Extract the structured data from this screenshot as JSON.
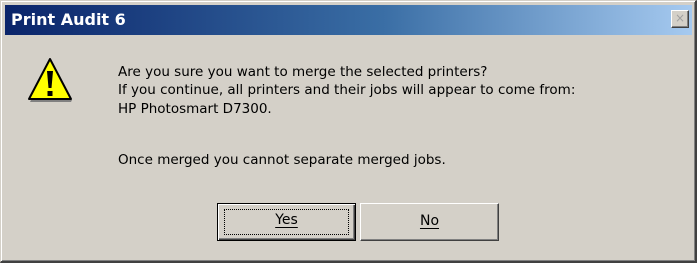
{
  "window": {
    "title": "Print Audit 6",
    "close_glyph": "×"
  },
  "icon": {
    "name": "warning-icon",
    "color": "#ffff00"
  },
  "message": {
    "line1": "Are you sure you want to merge the selected printers?",
    "line2": "If you continue, all printers and their jobs will appear to come from:",
    "line3": "HP Photosmart D7300.",
    "line4": "Once merged you cannot separate merged jobs."
  },
  "buttons": {
    "yes_label": "Yes",
    "no_label": "No"
  },
  "colors": {
    "titlebar_start": "#0a246a",
    "titlebar_end": "#a6caf0",
    "dialog_bg": "#d4d0c8"
  }
}
